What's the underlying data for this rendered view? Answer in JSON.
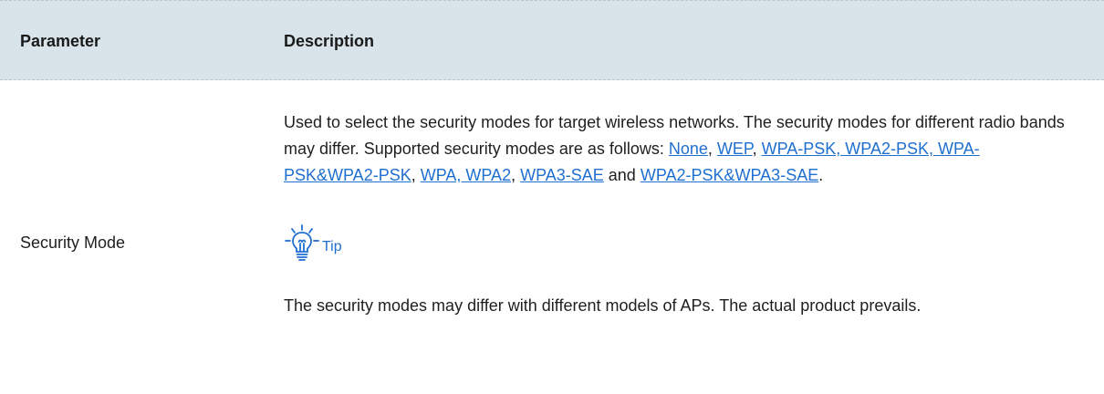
{
  "table": {
    "headers": {
      "parameter": "Parameter",
      "description": "Description"
    },
    "row": {
      "parameter": "Security Mode",
      "description": {
        "intro": "Used to select the security modes for target wireless networks. The security modes for different radio bands may differ. Supported security modes are as follows: ",
        "links": [
          "None",
          "WEP",
          "WPA-PSK, WPA2-PSK, WPA-PSK&WPA2-PSK",
          "WPA, WPA2",
          "WPA3-SAE",
          "WPA2-PSK&WPA3-SAE"
        ],
        "sep1": ", ",
        "sep2": ", ",
        "sep3": ", ",
        "sep4": ", ",
        "and_word": " and ",
        "end": "."
      },
      "tip": {
        "icon": "lightbulb-icon",
        "label": "Tip",
        "text": "The security modes may differ with different models of APs. The actual product prevails."
      }
    }
  },
  "colors": {
    "header_bg": "#d9e4ea",
    "link": "#1f6fd1",
    "text": "#1f1f1f"
  }
}
